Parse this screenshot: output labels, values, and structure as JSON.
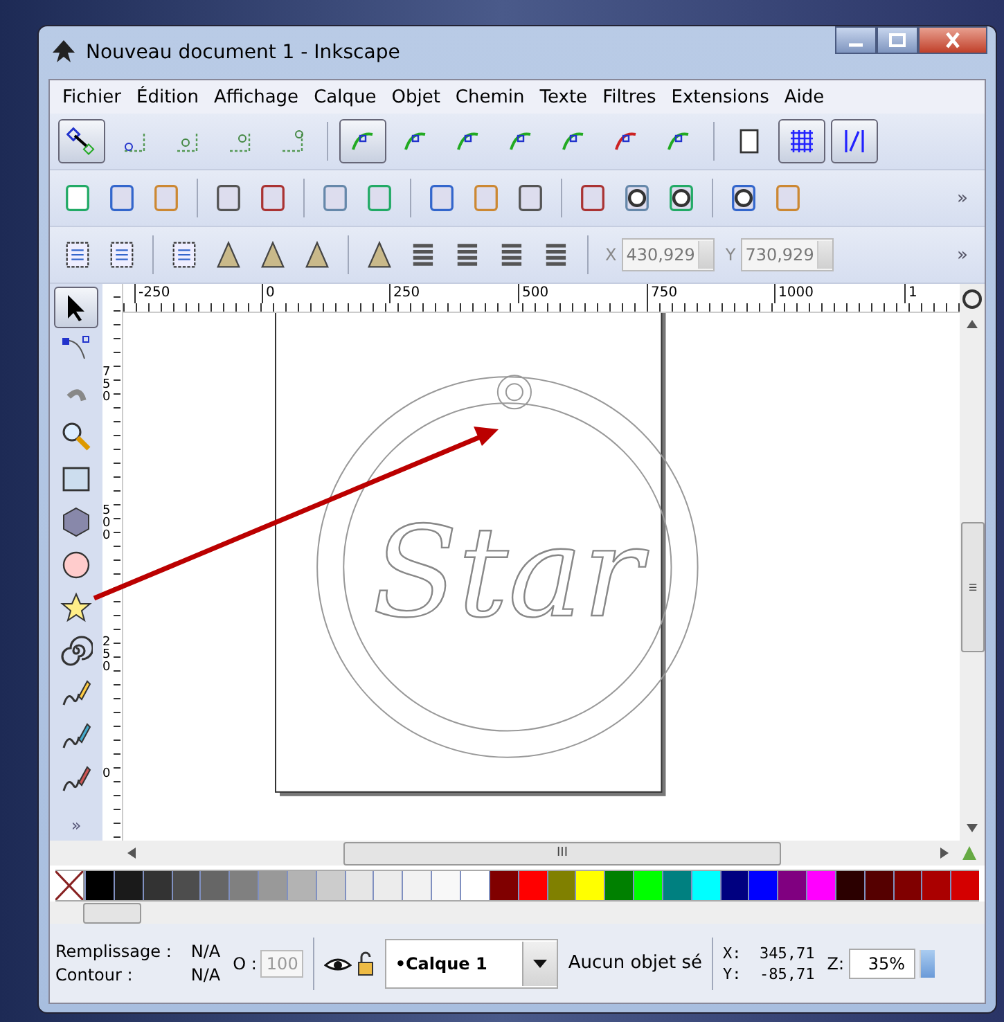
{
  "window": {
    "title": "Nouveau document 1 - Inkscape"
  },
  "menu": [
    "Fichier",
    "Édition",
    "Affichage",
    "Calque",
    "Objet",
    "Chemin",
    "Texte",
    "Filtres",
    "Extensions",
    "Aide"
  ],
  "snap_bar": [
    {
      "selected": true
    },
    {
      "selected": false
    },
    {
      "selected": false
    },
    {
      "selected": false
    },
    {
      "selected": false
    },
    {
      "selected": true
    },
    {
      "selected": false
    },
    {
      "selected": false
    },
    {
      "selected": false
    },
    {
      "selected": false
    },
    {
      "selected": false
    },
    {
      "selected": false
    },
    {
      "selected": false
    },
    {
      "selected": true
    },
    {
      "selected": true
    }
  ],
  "toolbar_overflow": "»",
  "selector_bar": {
    "x_label": "X",
    "x_value": "430,929",
    "y_label": "Y",
    "y_value": "730,929",
    "overflow": "»"
  },
  "ruler": {
    "labels": [
      "-250",
      "0",
      "250",
      "500",
      "750",
      "1000",
      "1"
    ],
    "vertical_labels": [
      "750",
      "500",
      "250",
      "0"
    ]
  },
  "tools": [
    {
      "selected": true
    },
    {
      "selected": false
    },
    {
      "selected": false
    },
    {
      "selected": false
    },
    {
      "selected": false
    },
    {
      "selected": false
    },
    {
      "selected": false
    },
    {
      "selected": false
    },
    {
      "selected": false
    },
    {
      "selected": false
    },
    {
      "selected": false
    },
    {
      "selected": false
    }
  ],
  "tools_overflow": "»",
  "artwork_text": "Star",
  "hscroll_grip": "III",
  "vscroll_grip": "III",
  "palette": [
    {
      "color": "#000000"
    },
    {
      "color": "#1a1a1a"
    },
    {
      "color": "#333333"
    },
    {
      "color": "#4d4d4d"
    },
    {
      "color": "#666666"
    },
    {
      "color": "#808080"
    },
    {
      "color": "#999999"
    },
    {
      "color": "#b3b3b3"
    },
    {
      "color": "#cccccc"
    },
    {
      "color": "#e6e6e6"
    },
    {
      "color": "#ececec"
    },
    {
      "color": "#f2f2f2"
    },
    {
      "color": "#f8f8f8"
    },
    {
      "color": "#ffffff"
    },
    {
      "color": "#800000"
    },
    {
      "color": "#ff0000"
    },
    {
      "color": "#808000"
    },
    {
      "color": "#ffff00"
    },
    {
      "color": "#008000"
    },
    {
      "color": "#00ff00"
    },
    {
      "color": "#008080"
    },
    {
      "color": "#00ffff"
    },
    {
      "color": "#000080"
    },
    {
      "color": "#0000ff"
    },
    {
      "color": "#800080"
    },
    {
      "color": "#ff00ff"
    },
    {
      "color": "#2b0000"
    },
    {
      "color": "#550000"
    },
    {
      "color": "#800000"
    },
    {
      "color": "#aa0000"
    },
    {
      "color": "#d40000"
    }
  ],
  "status_bar": {
    "fill_label": "Remplissage :",
    "fill_value": "N/A",
    "stroke_label": "Contour :",
    "stroke_value": "N/A",
    "opacity_label": "O :",
    "opacity_value": "100",
    "layer": "•Calque 1",
    "message": "Aucun objet sé",
    "cursor_x": "X:  345,71",
    "cursor_y": "Y:  -85,71",
    "zoom_label": "Z:",
    "zoom_value": "35%"
  }
}
